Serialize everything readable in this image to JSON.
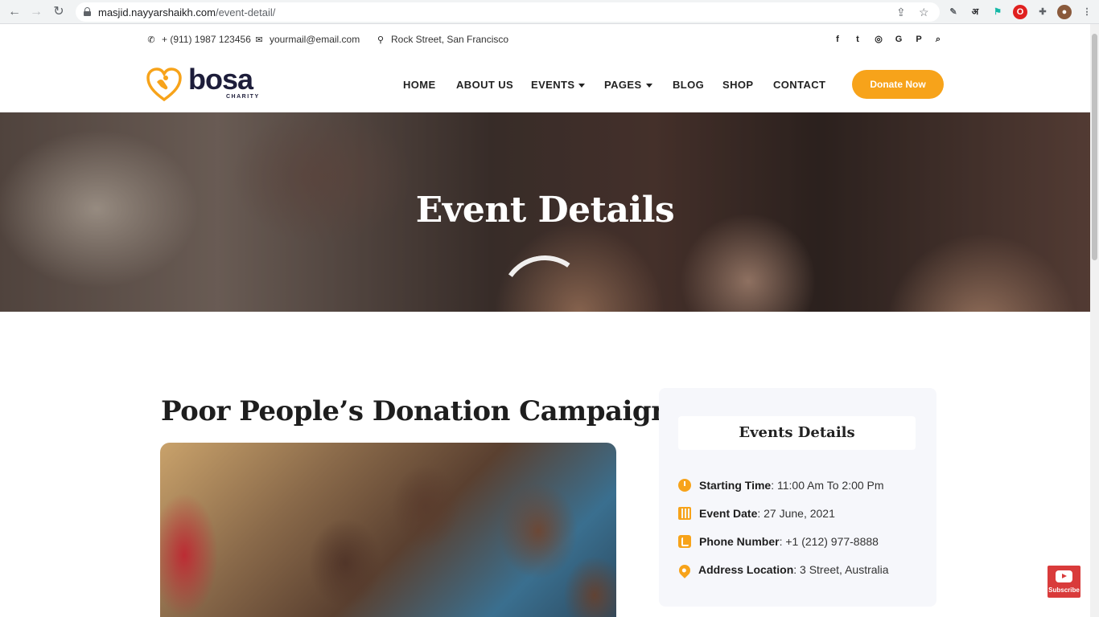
{
  "browser": {
    "url_host": "masjid.nayyarshaikh.com",
    "url_path": "/event-detail/",
    "icons": [
      "back-arrow-icon",
      "forward-arrow-icon",
      "reload-icon",
      "lock-icon",
      "share-icon",
      "star-icon",
      "eyedropper-icon",
      "hindi-a-icon",
      "extension-icon",
      "opera-icon",
      "puzzle-icon",
      "profile-icon",
      "kebab-menu-icon"
    ],
    "ext_hindi": "अ"
  },
  "topbar": {
    "phone": "+ (911) 1987 123456",
    "email": "yourmail@email.com",
    "address": "Rock Street, San Francisco",
    "social_icons": [
      "facebook-icon",
      "twitter-icon",
      "instagram-icon",
      "google-icon",
      "pinterest-icon",
      "search-icon"
    ]
  },
  "logo": {
    "word": "bosa",
    "sub": "CHARITY"
  },
  "nav": {
    "home": "HOME",
    "about": "ABOUT US",
    "events": "EVENTS",
    "pages": "PAGES",
    "blog": "BLOG",
    "shop": "SHOP",
    "contact": "CONTACT",
    "donate": "Donate Now"
  },
  "hero": {
    "title": "Event Details"
  },
  "campaign": {
    "title": "Poor People’s Donation Campaign"
  },
  "sidebar": {
    "heading": "Events Details",
    "rows": [
      {
        "label": "Starting Time",
        "value": ": 11:00 Am To 2:00 Pm",
        "icon": "clock-icon"
      },
      {
        "label": "Event Date",
        "value": ": 27 June, 2021",
        "icon": "calendar-icon"
      },
      {
        "label": "Phone Number",
        "value": ": +1 (212) 977-8888",
        "icon": "phone-icon"
      },
      {
        "label": "Address Location",
        "value": ": 3 Street, Australia",
        "icon": "location-pin-icon"
      }
    ]
  },
  "youtube": {
    "label": "Subscribe"
  },
  "colors": {
    "accent": "#f7a31a",
    "text_dark": "#1e1e1e",
    "sidebar_bg": "#f6f7fb"
  }
}
